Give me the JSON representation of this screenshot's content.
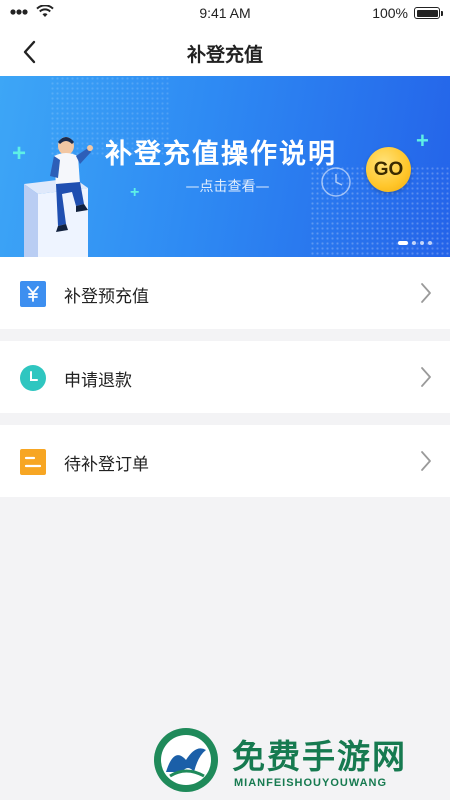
{
  "status_bar": {
    "time": "9:41 AM",
    "battery": "100%"
  },
  "nav": {
    "title": "补登充值",
    "back_icon": "chevron-left-icon"
  },
  "banner": {
    "title": "补登充值操作说明",
    "subtitle": "—点击查看—",
    "go_label": "GO"
  },
  "menu": [
    {
      "label": "补登预充值",
      "icon": "yen-icon",
      "color": "#3d8ff0"
    },
    {
      "label": "申请退款",
      "icon": "clock-icon",
      "color": "#2fc6c0"
    },
    {
      "label": "待补登订单",
      "icon": "order-list-icon",
      "color": "#f7a623"
    }
  ],
  "watermark": {
    "text": "免费手游网",
    "sub": "MIANFEISHOUYOUWANG"
  }
}
